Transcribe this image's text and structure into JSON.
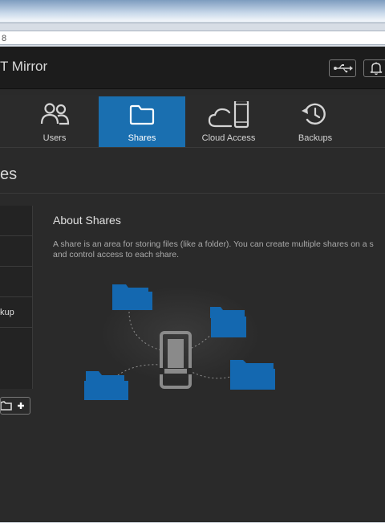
{
  "address_bar": {
    "text": "8"
  },
  "app": {
    "title": "T Mirror"
  },
  "header": {
    "usb_icon": "usb-icon",
    "bell_icon": "bell-icon"
  },
  "tabs": [
    {
      "label": "Users",
      "icon": "users-icon",
      "active": false
    },
    {
      "label": "Shares",
      "icon": "folder-icon",
      "active": true
    },
    {
      "label": "Cloud Access",
      "icon": "cloud-device-icon",
      "active": false
    },
    {
      "label": "Backups",
      "icon": "history-icon",
      "active": false
    }
  ],
  "page": {
    "title": "es"
  },
  "share_list": {
    "items": [
      {
        "label": ""
      },
      {
        "label": ""
      },
      {
        "label": ""
      },
      {
        "label": "kup"
      }
    ]
  },
  "about": {
    "title": "About Shares",
    "text_line1": "A share is an area for storing files (like a folder). You can create multiple shares on a s",
    "text_line2": "and control access to each share."
  },
  "colors": {
    "accent": "#1a6fb0",
    "folder": "#1468b0"
  }
}
